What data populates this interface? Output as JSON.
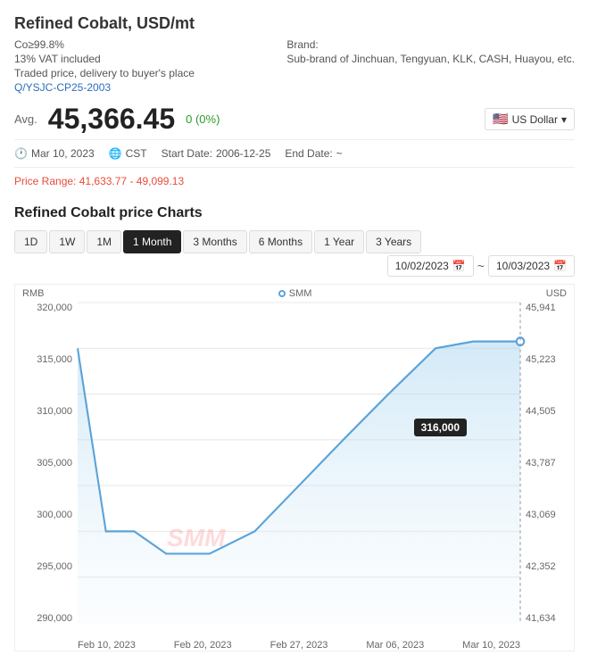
{
  "page": {
    "title": "Refined Cobalt, USD/mt",
    "meta": {
      "purity": "Co≥99.8%",
      "vat": "13% VAT included",
      "delivery": "Traded price, delivery to buyer's place",
      "link": "Q/YSJC-CP25-2003",
      "brand_label": "Brand:",
      "brand_value": "Sub-brand of Jinchuan, Tengyuan, KLK, CASH, Huayou, etc."
    },
    "avg_label": "Avg.",
    "avg_value": "45,366.45",
    "change_value": "0 (0%)",
    "currency": "US Dollar",
    "date_info": {
      "date": "Mar 10, 2023",
      "timezone": "CST",
      "start_label": "Start Date:",
      "start_value": "2006-12-25",
      "end_label": "End Date:",
      "end_value": "~"
    },
    "price_range_label": "Price Range:",
    "price_range_value": "41,633.77 - 49,099.13",
    "chart_title": "Refined Cobalt price Charts",
    "toolbar": {
      "buttons": [
        "1D",
        "1W",
        "1M",
        "1 Month",
        "3 Months",
        "6 Months",
        "1 Year",
        "3 Years"
      ],
      "active_index": 3,
      "date_from": "10/02/2023",
      "date_to": "10/03/2023"
    },
    "chart": {
      "rmb_label": "RMB",
      "usd_label": "USD",
      "legend_label": "SMM",
      "y_left": [
        "320,000",
        "315,000",
        "310,000",
        "305,000",
        "300,000",
        "295,000",
        "290,000"
      ],
      "y_right": [
        "45,941",
        "45,223",
        "44,505",
        "43,787",
        "43,069",
        "42,352",
        "41,634"
      ],
      "x_labels": [
        "Feb 10, 2023",
        "Feb 20, 2023",
        "Feb 27, 2023",
        "Mar 06, 2023",
        "Mar 10, 2023"
      ],
      "tooltip_value": "316,000",
      "watermark": "SMM"
    }
  }
}
